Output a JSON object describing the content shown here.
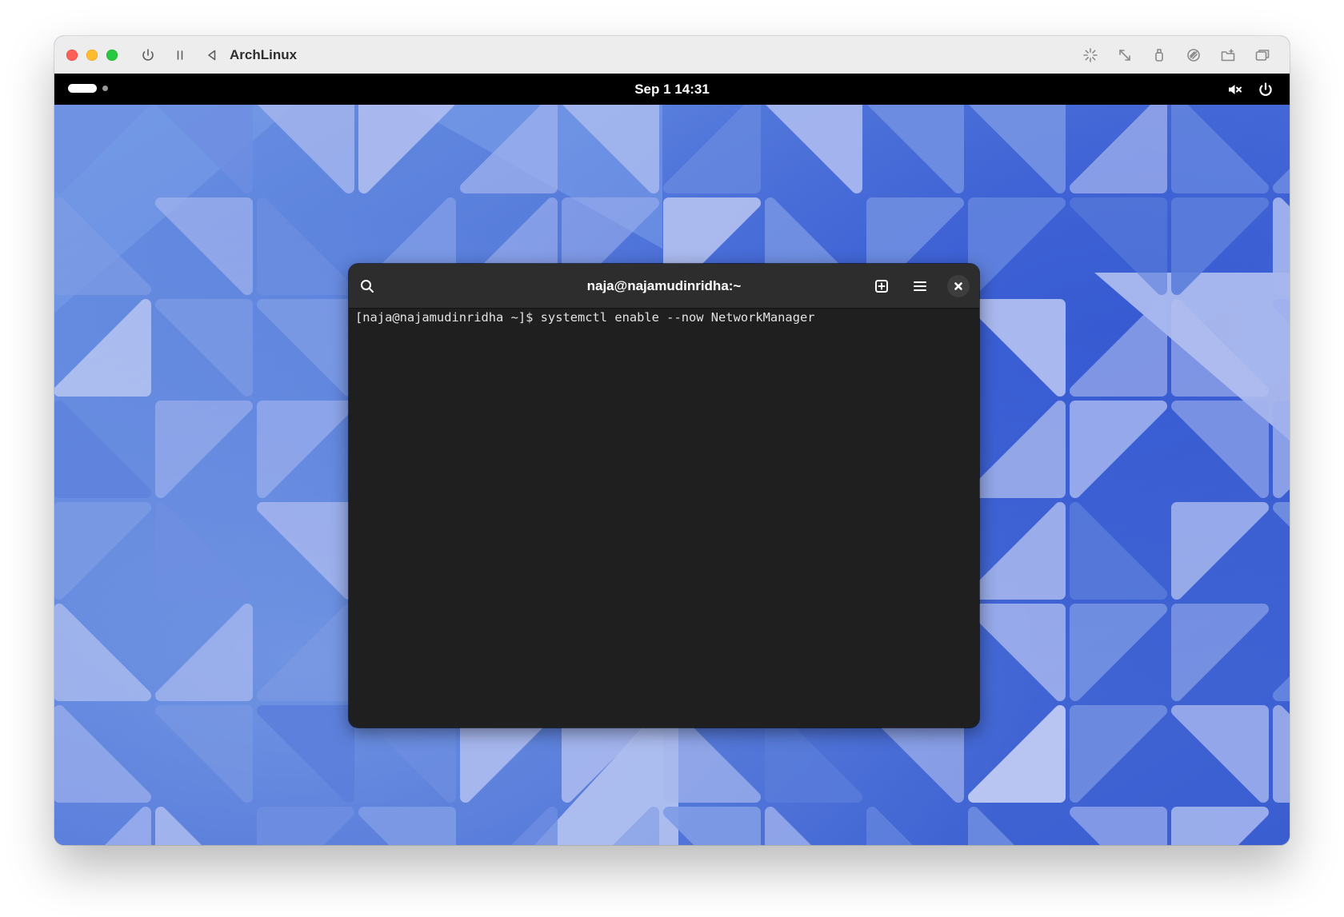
{
  "vm": {
    "title": "ArchLinux",
    "controls": [
      "power-icon",
      "pause-icon",
      "back-icon"
    ],
    "right_tools": [
      "brightness-icon",
      "resize-icon",
      "usb-icon",
      "network-icon",
      "shared-folder-icon",
      "window-icon"
    ]
  },
  "topbar": {
    "clock": "Sep 1  14:31",
    "status_icons": [
      "volume-muted-icon",
      "power-icon"
    ]
  },
  "terminal": {
    "title": "naja@najamudinridha:~",
    "prompt": "[naja@najamudinridha ~]$ ",
    "command": "systemctl enable --now NetworkManager",
    "header_icons": [
      "search-icon",
      "new-tab-icon",
      "hamburger-menu-icon",
      "close-icon"
    ]
  },
  "colors": {
    "wallpaper_base": "#2f56cc",
    "wallpaper_light": "#b3bff0",
    "terminal_bg": "#1f1f1f",
    "terminal_header": "#2d2d2d",
    "topbar_bg": "#000000"
  }
}
